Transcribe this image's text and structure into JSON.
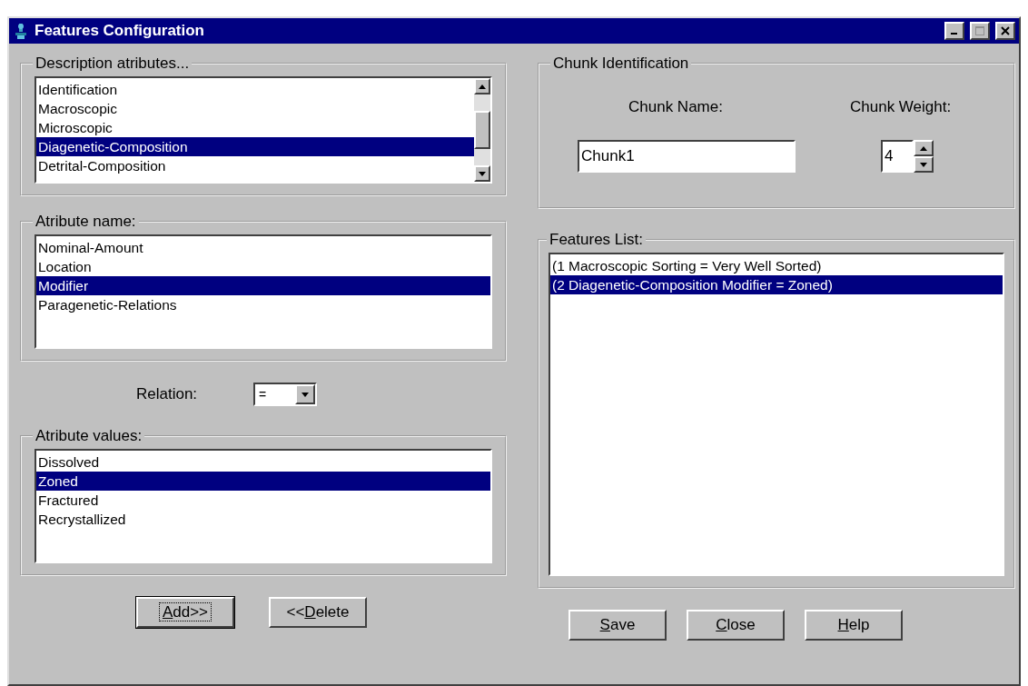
{
  "window": {
    "title": "Features Configuration"
  },
  "description_attributes": {
    "legend": "Description atributes...",
    "items": [
      {
        "label": "Identification",
        "selected": false
      },
      {
        "label": "Macroscopic",
        "selected": false
      },
      {
        "label": "Microscopic",
        "selected": false
      },
      {
        "label": "Diagenetic-Composition",
        "selected": true
      },
      {
        "label": "Detrital-Composition",
        "selected": false
      }
    ]
  },
  "attribute_name": {
    "legend": "Atribute name:",
    "items": [
      {
        "label": "Nominal-Amount",
        "selected": false
      },
      {
        "label": "Location",
        "selected": false
      },
      {
        "label": "Modifier",
        "selected": true
      },
      {
        "label": "Paragenetic-Relations",
        "selected": false
      }
    ]
  },
  "relation": {
    "label": "Relation:",
    "value": "="
  },
  "attribute_values": {
    "legend": "Atribute values:",
    "items": [
      {
        "label": "Dissolved",
        "selected": false
      },
      {
        "label": "Zoned",
        "selected": true
      },
      {
        "label": "Fractured",
        "selected": false
      },
      {
        "label": "Recrystallized",
        "selected": false
      }
    ]
  },
  "chunk_identification": {
    "legend": "Chunk Identification",
    "name_label": "Chunk Name:",
    "name_value": "Chunk1",
    "weight_label": "Chunk Weight:",
    "weight_value": "4"
  },
  "features_list": {
    "legend": "Features List:",
    "items": [
      {
        "label": "(1 Macroscopic Sorting = Very Well Sorted)",
        "selected": false
      },
      {
        "label": "(2 Diagenetic-Composition Modifier = Zoned)",
        "selected": true
      }
    ]
  },
  "left_buttons": [
    {
      "key": "A",
      "rest": "dd>>",
      "focused": true
    },
    {
      "prefix": "<<",
      "key": "D",
      "rest": "elete",
      "focused": false
    }
  ],
  "right_buttons": [
    {
      "key": "S",
      "rest": "ave",
      "focused": false
    },
    {
      "key": "C",
      "rest": "lose",
      "focused": false
    },
    {
      "key": "H",
      "rest": "elp",
      "focused": false
    }
  ]
}
